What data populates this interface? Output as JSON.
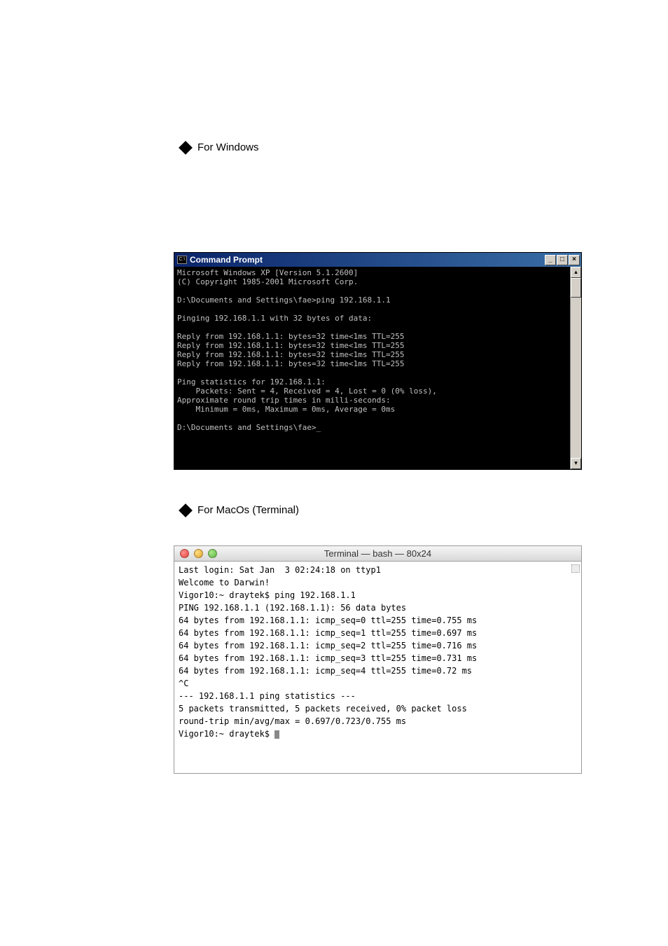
{
  "bullets": {
    "windows_label": "For Windows",
    "mac_label": "For MacOs (Terminal)"
  },
  "cmd": {
    "icon_text": "C:\\",
    "title": "Command Prompt",
    "btn_min": "_",
    "btn_max": "□",
    "btn_close": "×",
    "scroll_up": "▴",
    "scroll_down": "▾",
    "lines": {
      "l1": "Microsoft Windows XP [Version 5.1.2600]",
      "l2": "(C) Copyright 1985-2001 Microsoft Corp.",
      "l3": "",
      "l4": "D:\\Documents and Settings\\fae>ping 192.168.1.1",
      "l5": "",
      "l6": "Pinging 192.168.1.1 with 32 bytes of data:",
      "l7": "",
      "l8": "Reply from 192.168.1.1: bytes=32 time<1ms TTL=255",
      "l9": "Reply from 192.168.1.1: bytes=32 time<1ms TTL=255",
      "l10": "Reply from 192.168.1.1: bytes=32 time<1ms TTL=255",
      "l11": "Reply from 192.168.1.1: bytes=32 time<1ms TTL=255",
      "l12": "",
      "l13": "Ping statistics for 192.168.1.1:",
      "l14": "    Packets: Sent = 4, Received = 4, Lost = 0 (0% loss),",
      "l15": "Approximate round trip times in milli-seconds:",
      "l16": "    Minimum = 0ms, Maximum = 0ms, Average = 0ms",
      "l17": "",
      "l18": "D:\\Documents and Settings\\fae>_"
    }
  },
  "mac": {
    "title": "Terminal — bash — 80x24",
    "lines": {
      "l1": "Last login: Sat Jan  3 02:24:18 on ttyp1",
      "l2": "Welcome to Darwin!",
      "l3": "Vigor10:~ draytek$ ping 192.168.1.1",
      "l4": "PING 192.168.1.1 (192.168.1.1): 56 data bytes",
      "l5": "64 bytes from 192.168.1.1: icmp_seq=0 ttl=255 time=0.755 ms",
      "l6": "64 bytes from 192.168.1.1: icmp_seq=1 ttl=255 time=0.697 ms",
      "l7": "64 bytes from 192.168.1.1: icmp_seq=2 ttl=255 time=0.716 ms",
      "l8": "64 bytes from 192.168.1.1: icmp_seq=3 ttl=255 time=0.731 ms",
      "l9": "64 bytes from 192.168.1.1: icmp_seq=4 ttl=255 time=0.72 ms",
      "l10": "^C",
      "l11": "--- 192.168.1.1 ping statistics ---",
      "l12": "5 packets transmitted, 5 packets received, 0% packet loss",
      "l13": "round-trip min/avg/max = 0.697/0.723/0.755 ms",
      "l14": "Vigor10:~ draytek$ "
    }
  }
}
